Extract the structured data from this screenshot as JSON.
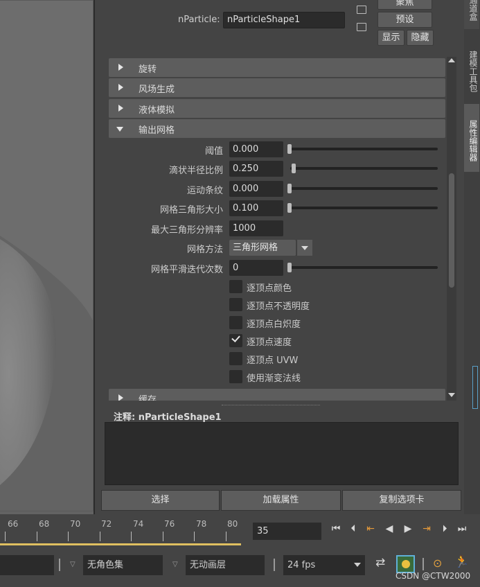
{
  "header": {
    "nparticle_label": "nParticle:",
    "nparticle_value": "nParticleShape1",
    "btn_focus": "聚焦",
    "btn_preset": "预设",
    "btn_show": "显示",
    "btn_hide": "隐藏"
  },
  "sections": [
    {
      "label": "旋转",
      "expanded": false
    },
    {
      "label": "风场生成",
      "expanded": false
    },
    {
      "label": "液体模拟",
      "expanded": false
    },
    {
      "label": "输出网格",
      "expanded": true
    },
    {
      "label": "缓存",
      "expanded": false
    }
  ],
  "output_mesh": {
    "threshold": {
      "label": "阈值",
      "value": "0.000",
      "slider": 0.0
    },
    "blobby_radius": {
      "label": "滴状半径比例",
      "value": "0.250",
      "slider": 0.03
    },
    "motion_streak": {
      "label": "运动条纹",
      "value": "0.000",
      "slider": 0.0
    },
    "triangle_size": {
      "label": "网格三角形大小",
      "value": "0.100",
      "slider": 0.0
    },
    "max_triangle_res": {
      "label": "最大三角形分辨率",
      "value": "1000"
    },
    "mesh_method": {
      "label": "网格方法",
      "value": "三角形网格"
    },
    "mesh_smoothing": {
      "label": "网格平滑迭代次数",
      "value": "0",
      "slider": 0.0
    },
    "checkboxes": [
      {
        "label": "逐顶点颜色",
        "checked": false
      },
      {
        "label": "逐顶点不透明度",
        "checked": false
      },
      {
        "label": "逐顶点白炽度",
        "checked": false
      },
      {
        "label": "逐顶点速度",
        "checked": true
      },
      {
        "label": "逐顶点 UVW",
        "checked": false
      },
      {
        "label": "使用渐变法线",
        "checked": false
      }
    ]
  },
  "notes": {
    "label": "注释:",
    "node": "nParticleShape1"
  },
  "bottom_buttons": {
    "select": "选择",
    "load_attributes": "加载属性",
    "copy_tab": "复制选项卡"
  },
  "side_tabs": {
    "tab1": "通道盒",
    "tab2": "建模工具包",
    "tab3": "属性编辑器"
  },
  "timeline": {
    "ticks": [
      "66",
      "68",
      "70",
      "72",
      "74",
      "76",
      "78",
      "80"
    ],
    "current_frame": "35"
  },
  "status": {
    "character_set": "无角色集",
    "anim_layer": "无动画层",
    "fps": "24 fps"
  },
  "watermark": "CSDN @CTW2000"
}
